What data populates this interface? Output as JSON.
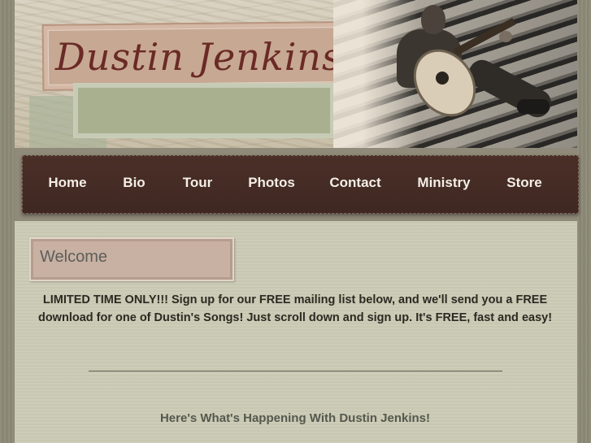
{
  "header": {
    "site_title": "Dustin Jenkins"
  },
  "nav": {
    "items": [
      {
        "label": "Home"
      },
      {
        "label": "Bio"
      },
      {
        "label": "Tour"
      },
      {
        "label": "Photos"
      },
      {
        "label": "Contact"
      },
      {
        "label": "Ministry"
      },
      {
        "label": "Store"
      }
    ]
  },
  "main": {
    "section_title": "Welcome",
    "promo_text": "LIMITED TIME ONLY!!!  Sign up for our FREE mailing list below, and we'll send you a FREE download  for one of Dustin's Songs!  Just scroll down and sign up.  It's FREE, fast and easy!",
    "happening_heading": "Here's What's Happening With Dustin Jenkins!"
  }
}
